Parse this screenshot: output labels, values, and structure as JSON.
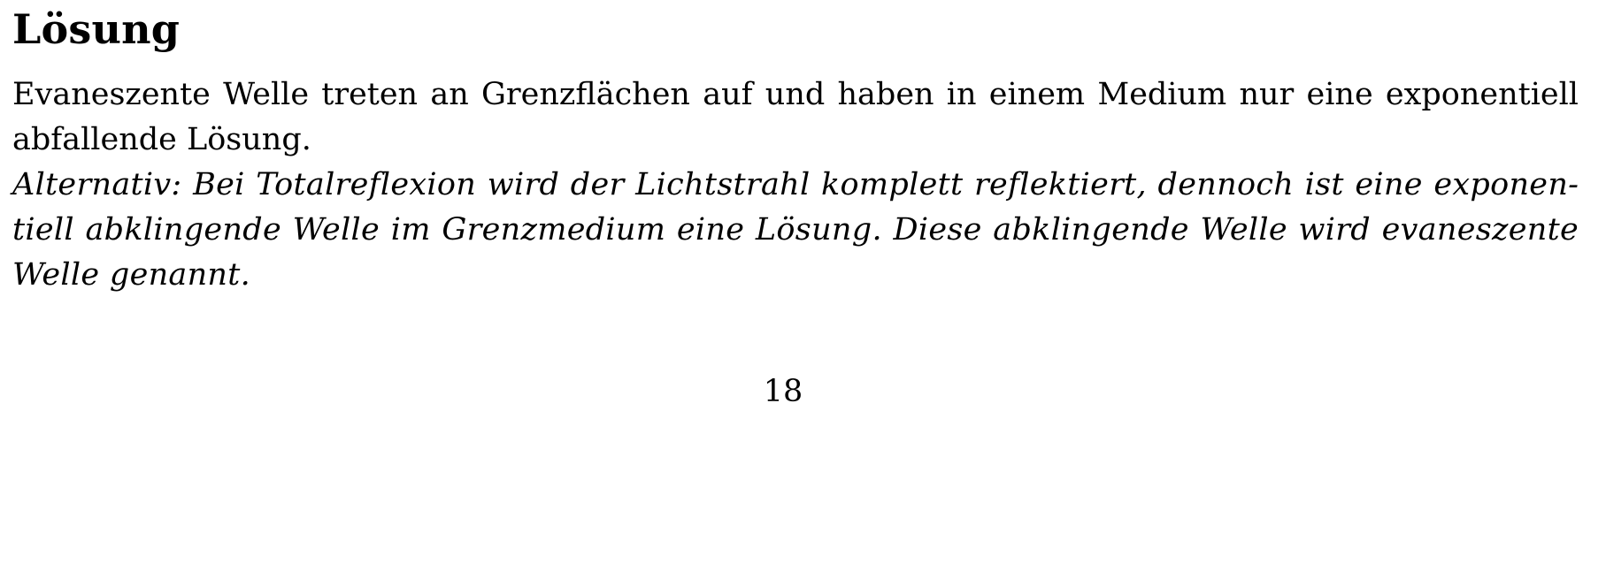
{
  "section": {
    "heading": "Lösung"
  },
  "body": {
    "paragraph": "Evaneszente Welle treten an Grenzflächen auf und haben in einem Medium nur eine exponentiell abfallende Lösung.",
    "alternative": "Alternativ: Bei Totalreflexion wird der Lichtstrahl komplett reflektiert, dennoch ist eine exponen­tiell abklingende Welle im Grenzmedium eine Lösung. Diese abklingende Welle wird evaneszente Welle genannt."
  },
  "footer": {
    "page_number": "18"
  }
}
